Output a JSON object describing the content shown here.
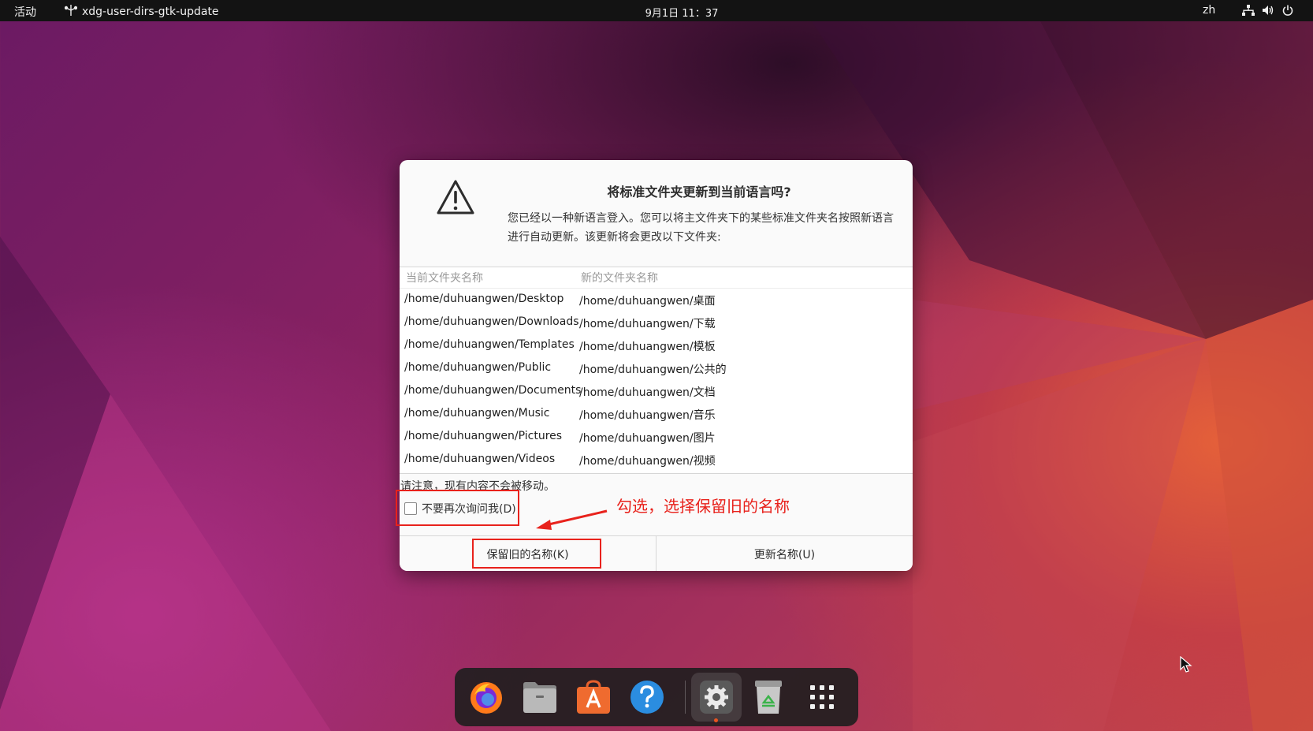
{
  "topbar": {
    "activities": "活动",
    "app_name": "xdg-user-dirs-gtk-update",
    "clock": "9月1日  11：37",
    "lang": "zh",
    "tray_icons": [
      "network-icon",
      "volume-icon",
      "power-icon"
    ]
  },
  "dialog": {
    "title": "将标准文件夹更新到当前语言吗?",
    "message": "您已经以一种新语言登入。您可以将主文件夹下的某些标准文件夹名按照新语言进行自动更新。该更新将会更改以下文件夹:",
    "columns": [
      "当前文件夹名称",
      "新的文件夹名称"
    ],
    "rows": [
      [
        "/home/duhuangwen/Desktop",
        "/home/duhuangwen/桌面"
      ],
      [
        "/home/duhuangwen/Downloads",
        "/home/duhuangwen/下载"
      ],
      [
        "/home/duhuangwen/Templates",
        "/home/duhuangwen/模板"
      ],
      [
        "/home/duhuangwen/Public",
        "/home/duhuangwen/公共的"
      ],
      [
        "/home/duhuangwen/Documents",
        "/home/duhuangwen/文档"
      ],
      [
        "/home/duhuangwen/Music",
        "/home/duhuangwen/音乐"
      ],
      [
        "/home/duhuangwen/Pictures",
        "/home/duhuangwen/图片"
      ],
      [
        "/home/duhuangwen/Videos",
        "/home/duhuangwen/视频"
      ]
    ],
    "note": "请注意，现有内容不会被移动。",
    "checkbox_label": "不要再次询问我(D)",
    "checkbox_checked": false,
    "keep_button": "保留旧的名称(K)",
    "update_button": "更新名称(U)"
  },
  "annotation": {
    "text": "勾选，选择保留旧的名称",
    "color": "#e8221c"
  },
  "dock": {
    "items": [
      "firefox-icon",
      "files-icon",
      "app-center-icon",
      "help-icon",
      "settings-icon",
      "trash-icon",
      "show-apps-icon"
    ],
    "active": "settings-icon",
    "indicator_color": "#e95420"
  }
}
